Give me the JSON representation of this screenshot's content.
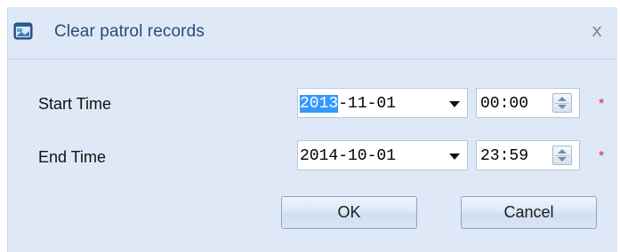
{
  "dialog": {
    "title": "Clear patrol records",
    "close_glyph": "x"
  },
  "form": {
    "start": {
      "label": "Start Time",
      "date_selected": "2013",
      "date_rest": "-11-01",
      "time": "00:00",
      "required_mark": "*"
    },
    "end": {
      "label": "End Time",
      "date": "2014-10-01",
      "time": "23:59",
      "required_mark": "*"
    }
  },
  "buttons": {
    "ok": "OK",
    "cancel": "Cancel"
  },
  "colors": {
    "dialog_bg": "#dfe8f6",
    "title_text": "#2a4a78",
    "required": "#e0262b",
    "selection": "#3399ff"
  },
  "icons": {
    "app": "window-app-icon",
    "close": "close-icon",
    "dropdown": "chevron-down-icon",
    "spinner": "spinner-up-down-icon"
  }
}
